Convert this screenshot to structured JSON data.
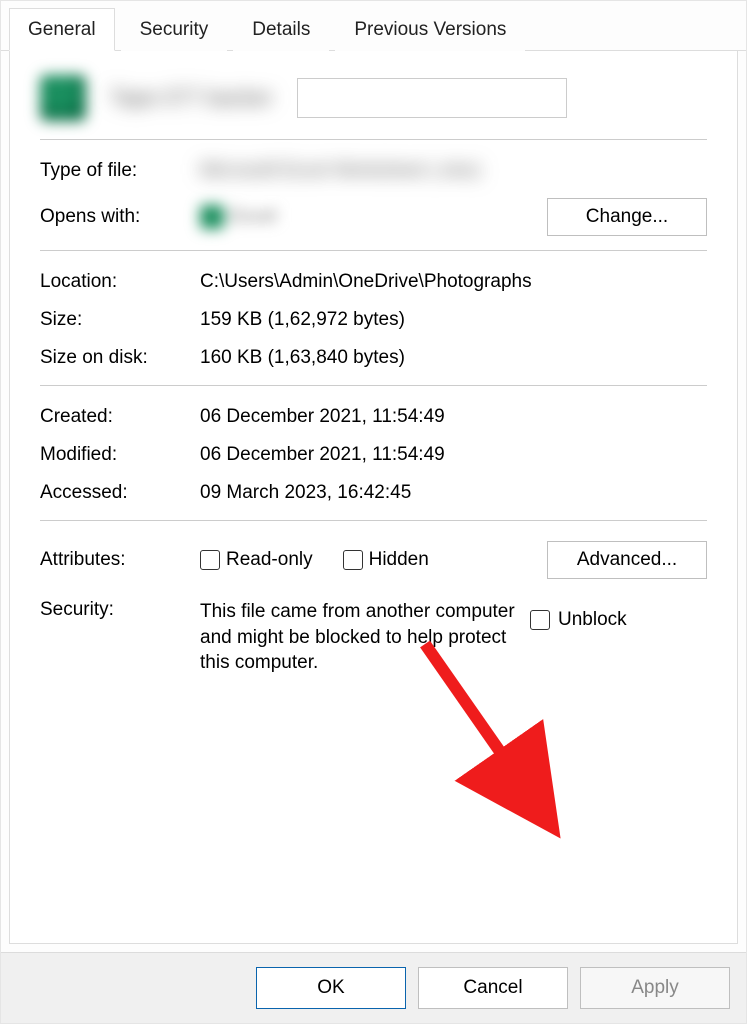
{
  "tabs": {
    "general": "General",
    "security": "Security",
    "details": "Details",
    "previous_versions": "Previous Versions"
  },
  "header": {
    "filename_blurred": "Tape 077 backer"
  },
  "file": {
    "type_label": "Type of file:",
    "type_value_blurred": "Microsoft Excel Worksheet (.xlsx)",
    "opens_with_label": "Opens with:",
    "opens_with_app_blurred": "Excel",
    "change_button": "Change..."
  },
  "info": {
    "location_label": "Location:",
    "location_value": "C:\\Users\\Admin\\OneDrive\\Photographs",
    "size_label": "Size:",
    "size_value": "159 KB (1,62,972 bytes)",
    "size_on_disk_label": "Size on disk:",
    "size_on_disk_value": "160 KB (1,63,840 bytes)"
  },
  "dates": {
    "created_label": "Created:",
    "created_value": "06 December 2021, 11:54:49",
    "modified_label": "Modified:",
    "modified_value": "06 December 2021, 11:54:49",
    "accessed_label": "Accessed:",
    "accessed_value": "09 March 2023, 16:42:45"
  },
  "attributes": {
    "label": "Attributes:",
    "read_only": "Read-only",
    "hidden": "Hidden",
    "advanced_button": "Advanced..."
  },
  "security": {
    "label": "Security:",
    "message": "This file came from another computer and might be blocked to help protect this computer.",
    "unblock": "Unblock"
  },
  "buttons": {
    "ok": "OK",
    "cancel": "Cancel",
    "apply": "Apply"
  }
}
